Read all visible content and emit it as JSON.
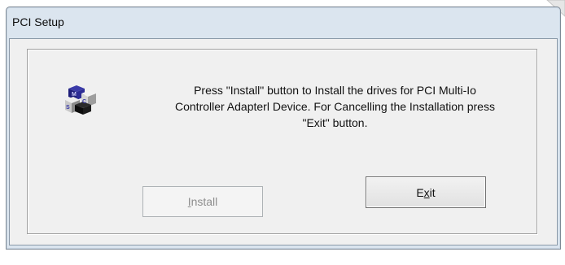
{
  "window": {
    "title": "PCI Setup"
  },
  "dialog": {
    "message_lines": [
      "Press \"Install\" button to Install the drives for PCI   Multi-Io",
      "Controller Adapterl Device. For Cancelling the Installation press",
      "\"Exit\" button."
    ],
    "install_button": {
      "prefix": "",
      "mnemonic": "I",
      "rest": "nstall",
      "enabled": false
    },
    "exit_button": {
      "prefix": "E",
      "mnemonic": "x",
      "rest": "it",
      "enabled": true
    }
  },
  "icons": {
    "app_icon": "msc-cubes-icon",
    "corner": "page-curl-icon"
  },
  "colors": {
    "window_frame": "#dbe5ef",
    "client_bg": "#f0f0f0",
    "disabled_text": "#8d8d8d"
  }
}
